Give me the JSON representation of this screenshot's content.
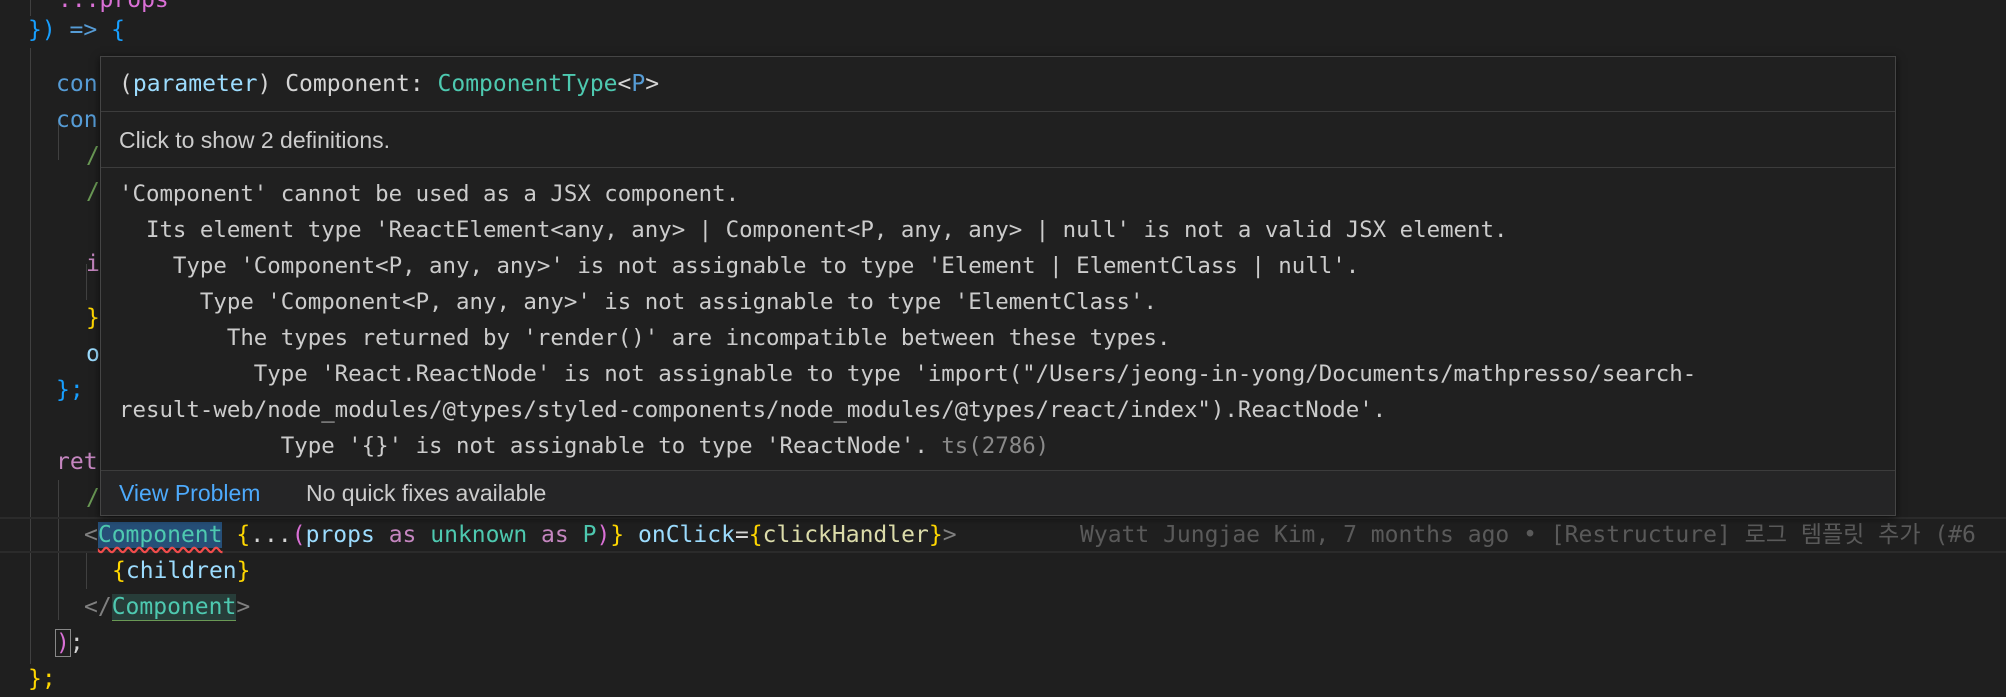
{
  "editor": {
    "lines": {
      "l0": "...props",
      "l1_a": "})",
      "l1_b": " => ",
      "l1_c": "{",
      "l2": "con",
      "l3": "con",
      "l4": "/",
      "l5": "/",
      "l6": "i",
      "l7": "}",
      "l8": "o",
      "l9": "};",
      "l10": "ret",
      "l11": "/",
      "l12_lt": "<",
      "l12_comp": "Component",
      "l12_sp": " ",
      "l12_ob": "{",
      "l12_spread": "...",
      "l12_op": "(",
      "l12_props": "props",
      "l12_as1": " as ",
      "l12_unknown": "unknown",
      "l12_as2": " as ",
      "l12_p": "P",
      "l12_cp": ")",
      "l12_cb": "}",
      "l12_onclick": " onClick",
      "l12_eq": "=",
      "l12_ob2": "{",
      "l12_handler": "clickHandler",
      "l12_cb2": "}",
      "l12_gt": ">",
      "l12_blame": "Wyatt Jungjae Kim, 7 months ago • [Restructure] 로그 템플릿 추가 (#6",
      "l13_ob": "{",
      "l13_children": "children",
      "l13_cb": "}",
      "l14_lt": "</",
      "l14_comp": "Component",
      "l14_gt": ">",
      "l15_p": ")",
      "l15_semi": ";",
      "l16": "};"
    }
  },
  "hover": {
    "sig_open": "(",
    "sig_kind": "parameter",
    "sig_close": ")",
    "sig_name": " Component: ",
    "sig_type": "ComponentType",
    "sig_lt": "<",
    "sig_p": "P",
    "sig_gt": ">",
    "definitions": "Click to show 2 definitions.",
    "message": [
      "'Component' cannot be used as a JSX component.",
      "  Its element type 'ReactElement<any, any> | Component<P, any, any> | null' is not a valid JSX element.",
      "    Type 'Component<P, any, any>' is not assignable to type 'Element | ElementClass | null'.",
      "      Type 'Component<P, any, any>' is not assignable to type 'ElementClass'.",
      "        The types returned by 'render()' are incompatible between these types.",
      "          Type 'React.ReactNode' is not assignable to type 'import(\"/Users/jeong-in-yong/Documents/mathpresso/search-",
      "result-web/node_modules/@types/styled-components/node_modules/@types/react/index\").ReactNode'.",
      "            Type '{}' is not assignable to type 'ReactNode'. "
    ],
    "error_code": "ts(2786)",
    "view_problem": "View Problem",
    "no_fixes": "No quick fixes available"
  },
  "colors": {
    "background": "#1f1f1f",
    "link": "#4daafc",
    "error_underline": "#f14c4c",
    "type": "#4ec9b0"
  }
}
